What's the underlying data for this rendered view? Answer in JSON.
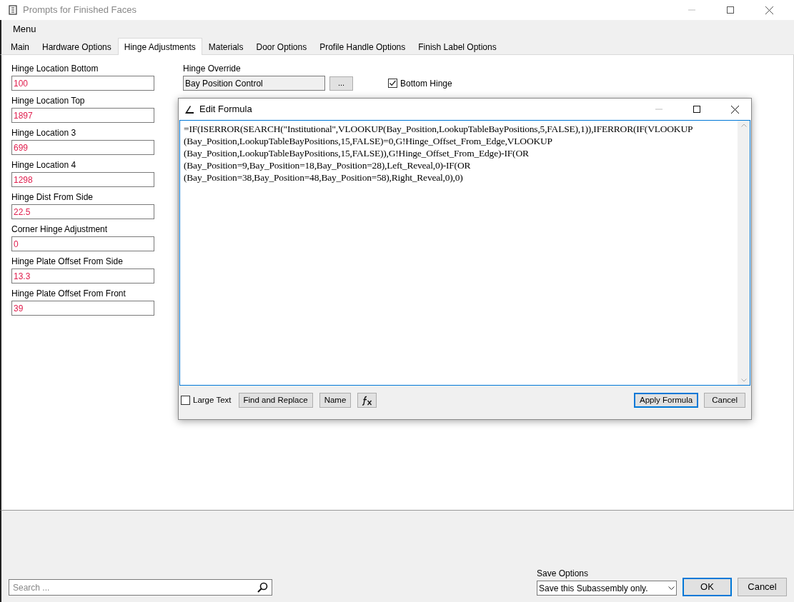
{
  "window": {
    "title": "Prompts for Finished Faces"
  },
  "menu": [
    "Menu"
  ],
  "tabs": [
    {
      "label": "Main",
      "selected": false
    },
    {
      "label": "Hardware Options",
      "selected": false
    },
    {
      "label": "Hinge Adjustments",
      "selected": true
    },
    {
      "label": "Materials",
      "selected": false
    },
    {
      "label": "Door Options",
      "selected": false
    },
    {
      "label": "Profile Handle Options",
      "selected": false
    },
    {
      "label": "Finish Label Options",
      "selected": false
    }
  ],
  "prompts": [
    {
      "label": "Hinge Location Bottom",
      "value": "100"
    },
    {
      "label": "Hinge Location Top",
      "value": "1897"
    },
    {
      "label": "Hinge Location 3",
      "value": "699"
    },
    {
      "label": "Hinge Location 4",
      "value": "1298"
    },
    {
      "label": "Hinge Dist From Side",
      "value": "22.5"
    },
    {
      "label": "Corner Hinge Adjustment",
      "value": "0"
    },
    {
      "label": "Hinge Plate Offset From Side",
      "value": "13.3"
    },
    {
      "label": "Hinge Plate Offset From Front",
      "value": "39"
    }
  ],
  "hinge_override": {
    "label": "Hinge Override",
    "value": "Bay Position Control",
    "button": "..."
  },
  "checkboxes": [
    {
      "label": "Bottom Hinge",
      "checked": true
    }
  ],
  "dialog": {
    "title": "Edit Formula",
    "formula_lines": [
      "=IF(ISERROR(SEARCH(\"Institutional\",VLOOKUP(Bay_Position,LookupTableBayPositions,5,FALSE),1)),IFERROR(IF(VLOOKUP",
      "(Bay_Position,LookupTableBayPositions,15,FALSE)=0,G!Hinge_Offset_From_Edge,VLOOKUP",
      "(Bay_Position,LookupTableBayPositions,15,FALSE)),G!Hinge_Offset_From_Edge)-IF(OR",
      "(Bay_Position=9,Bay_Position=18,Bay_Position=28),Left_Reveal,0)-IF(OR",
      "(Bay_Position=38,Bay_Position=48,Bay_Position=58),Right_Reveal,0),0)"
    ],
    "large_text": {
      "label": "Large Text",
      "checked": false
    },
    "buttons": [
      "Find and Replace",
      "Name"
    ],
    "apply": "Apply Formula",
    "cancel": "Cancel"
  },
  "search": {
    "placeholder": "Search ..."
  },
  "save_options": {
    "label": "Save Options",
    "value": "Save this Subassembly only."
  },
  "ok": "OK",
  "cancel": "Cancel"
}
